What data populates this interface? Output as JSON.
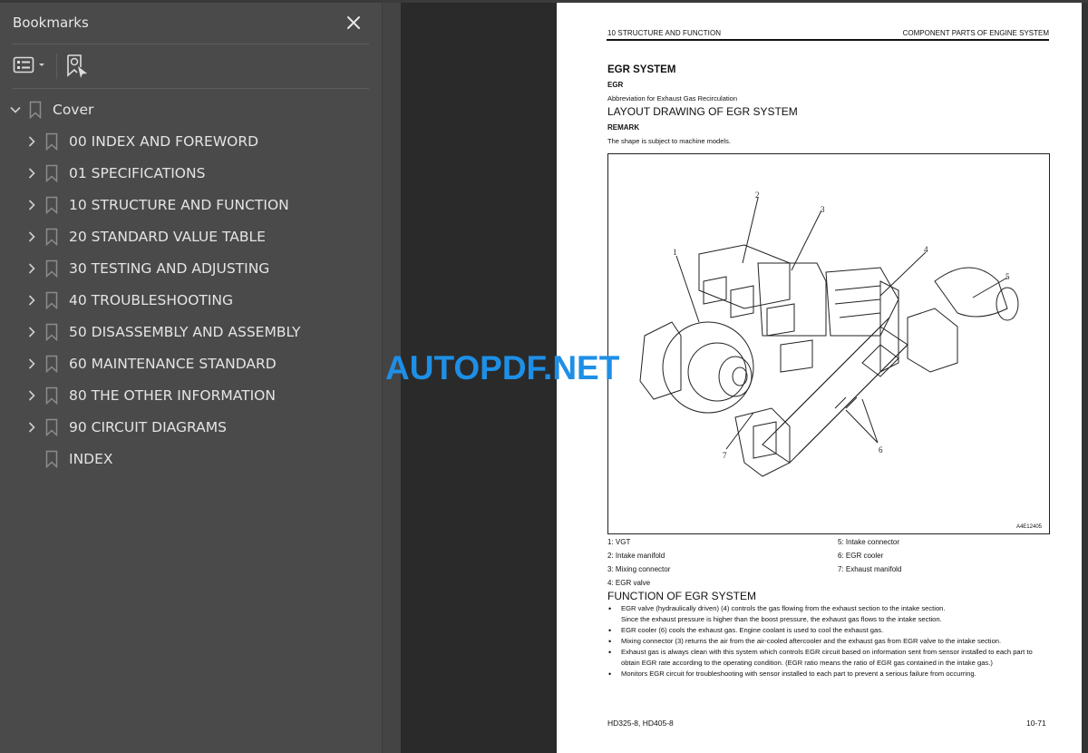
{
  "sidebar": {
    "title": "Bookmarks",
    "close_icon": "close-icon",
    "toolbar": {
      "options_icon": "list-options-icon",
      "find_bookmark_icon": "bookmark-find-icon"
    },
    "items": [
      {
        "label": "Cover",
        "expanded": true,
        "level": 0
      },
      {
        "label": "00 INDEX AND FOREWORD",
        "expanded": false,
        "level": 1
      },
      {
        "label": "01 SPECIFICATIONS",
        "expanded": false,
        "level": 1
      },
      {
        "label": "10 STRUCTURE AND FUNCTION",
        "expanded": false,
        "level": 1
      },
      {
        "label": "20 STANDARD VALUE TABLE",
        "expanded": false,
        "level": 1
      },
      {
        "label": "30 TESTING AND ADJUSTING",
        "expanded": false,
        "level": 1
      },
      {
        "label": "40 TROUBLESHOOTING",
        "expanded": false,
        "level": 1
      },
      {
        "label": "50 DISASSEMBLY AND ASSEMBLY",
        "expanded": false,
        "level": 1
      },
      {
        "label": "60 MAINTENANCE STANDARD",
        "expanded": false,
        "level": 1
      },
      {
        "label": "80 THE OTHER INFORMATION",
        "expanded": false,
        "level": 1
      },
      {
        "label": "90 CIRCUIT DIAGRAMS",
        "expanded": false,
        "level": 1
      },
      {
        "label": "INDEX",
        "expanded": null,
        "level": 1
      }
    ]
  },
  "page": {
    "header_left": "10 STRUCTURE AND FUNCTION",
    "header_right": "COMPONENT PARTS OF ENGINE SYSTEM",
    "heading": "EGR SYSTEM",
    "subheading": "EGR",
    "abbreviation": "Abbreviation for Exhaust Gas Recirculation",
    "layout_heading": "LAYOUT DRAWING OF EGR SYSTEM",
    "remark_label": "REMARK",
    "remark_text": "The shape is subject to machine models.",
    "figure": {
      "id": "A4E12405",
      "callouts": [
        "1",
        "2",
        "3",
        "4",
        "5",
        "6",
        "7"
      ]
    },
    "legend": [
      "1: VGT",
      "2: Intake manifold",
      "3: Mixing connector",
      "4: EGR valve",
      "5: Intake connector",
      "6: EGR cooler",
      "7: Exhaust manifold"
    ],
    "function_heading": "FUNCTION OF EGR SYSTEM",
    "bullets": [
      {
        "text": "EGR valve (hydraulically driven) (4) controls the gas flowing from the exhaust section to the intake section.",
        "cont": "Since the exhaust pressure is higher than the boost pressure, the exhaust gas flows to the intake section."
      },
      {
        "text": "EGR cooler (6) cools the exhaust gas. Engine coolant is used to cool the exhaust gas.",
        "cont": ""
      },
      {
        "text": "Mixing connector (3) returns the air from the air-cooled aftercooler and the exhaust gas from EGR valve to the intake section.",
        "cont": ""
      },
      {
        "text": "Exhaust gas is always clean with this system which controls EGR circuit based on information sent from sensor installed to each part to obtain EGR rate according to the operating condition. (EGR ratio means the ratio of EGR gas contained in the intake gas.)",
        "cont": ""
      },
      {
        "text": "Monitors EGR circuit for troubleshooting with sensor installed to each part to prevent a serious failure from occurring.",
        "cont": ""
      }
    ],
    "footer_left": "HD325-8, HD405-8",
    "footer_right": "10-71"
  },
  "watermark": "AUTOPDF.NET",
  "colors": {
    "sidebar_bg": "#4a4a4a",
    "viewer_bg": "#2a2a2a",
    "watermark": "#1e8fe6"
  }
}
